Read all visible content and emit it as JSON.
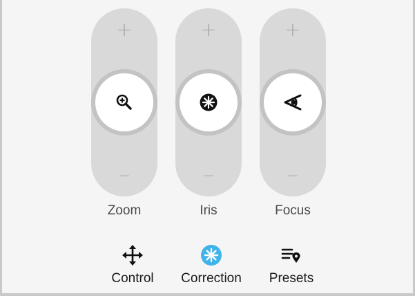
{
  "controls": {
    "zoom": {
      "label": "Zoom",
      "plus": "+",
      "minus": "−"
    },
    "iris": {
      "label": "Iris",
      "plus": "+",
      "minus": "−"
    },
    "focus": {
      "label": "Focus",
      "plus": "+",
      "minus": "−"
    }
  },
  "nav": {
    "control": {
      "label": "Control",
      "icon": "move-arrows-icon"
    },
    "correction": {
      "label": "Correction",
      "icon": "aperture-icon",
      "color": "#3fb3ea"
    },
    "presets": {
      "label": "Presets",
      "icon": "list-location-icon"
    }
  },
  "colors": {
    "pill": "#d9d9d9",
    "knob_ring": "#c3c3c3",
    "knob": "#ffffff",
    "accent": "#3fb3ea",
    "background": "#f5f5f5"
  }
}
